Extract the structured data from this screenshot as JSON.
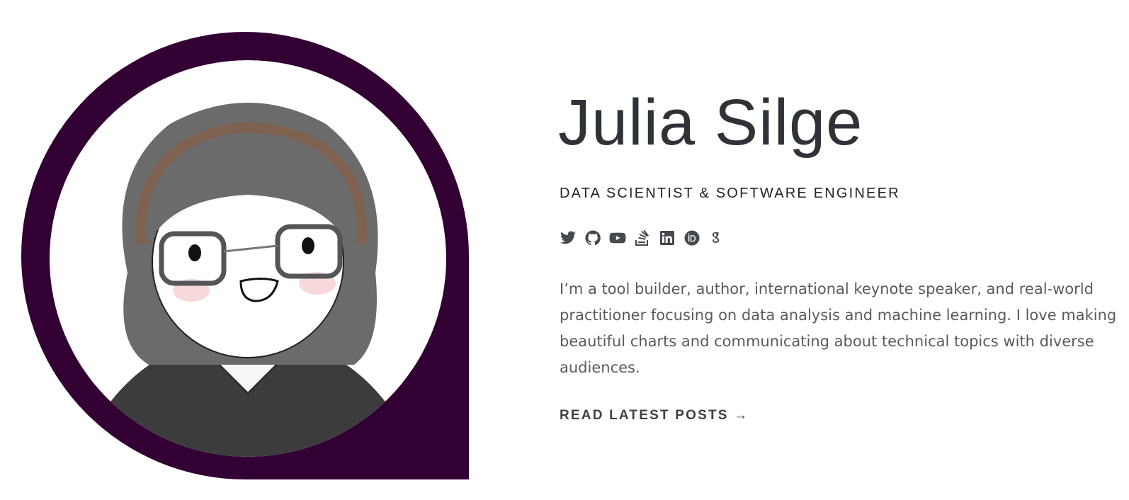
{
  "profile": {
    "name": "Julia Silge",
    "subtitle": "DATA SCIENTIST & SOFTWARE ENGINEER",
    "bio": "I’m a tool builder, author, international keynote speaker, and real-world practitioner focusing on data analysis and machine learning. I love making beautiful charts and communicating about technical topics with diverse audiences.",
    "cta": "READ LATEST POSTS →"
  },
  "socials": [
    {
      "icon": "twitter-icon"
    },
    {
      "icon": "github-icon"
    },
    {
      "icon": "youtube-icon"
    },
    {
      "icon": "stackoverflow-icon"
    },
    {
      "icon": "linkedin-icon"
    },
    {
      "icon": "orcid-icon"
    },
    {
      "icon": "google-scholar-icon"
    }
  ],
  "colors": {
    "avatar_frame": "#330033",
    "heading": "#2f3338",
    "body_text": "#575b60",
    "icon": "#454a50"
  }
}
